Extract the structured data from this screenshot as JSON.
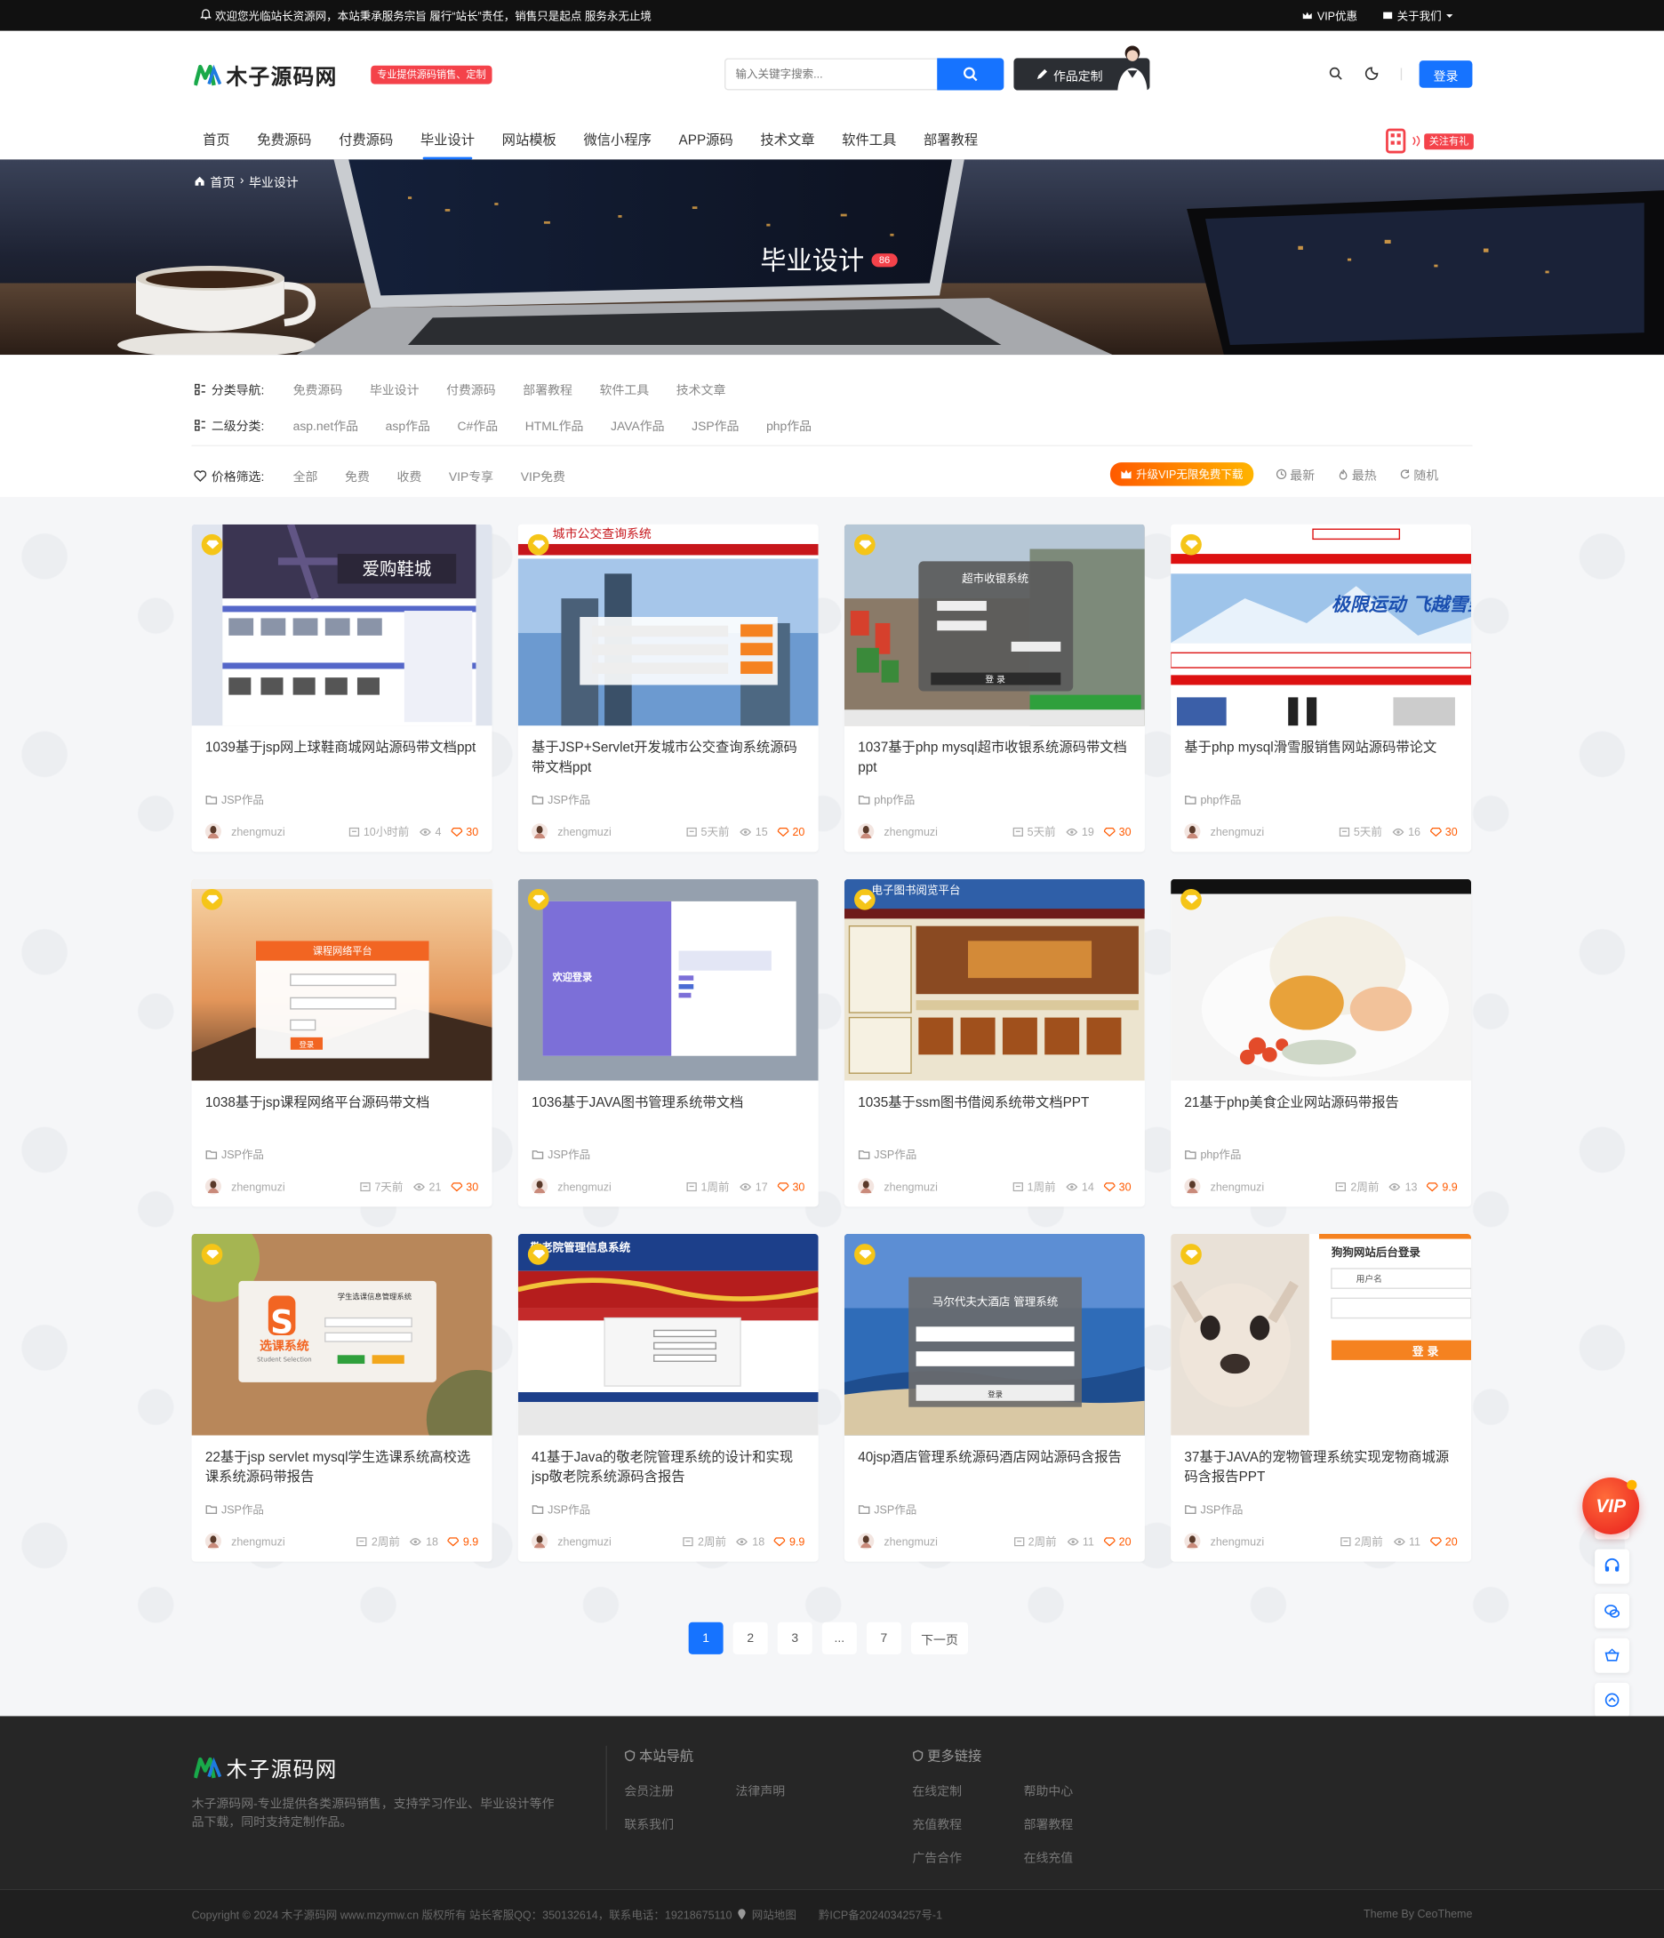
{
  "topbar": {
    "notice": "欢迎您光临站长资源网，本站秉承服务宗旨 履行“站长”责任，销售只是起点 服务永无止境",
    "vip": "VIP优惠",
    "about": "关于我们"
  },
  "header": {
    "logo_text": "木子源码网",
    "slogan": "专业提供源码销售、定制",
    "search_placeholder": "输入关键字搜索...",
    "custom_label": "作品定制",
    "login_label": "登录",
    "follow_label": "关注有礼"
  },
  "nav": [
    "首页",
    "免费源码",
    "付费源码",
    "毕业设计",
    "网站模板",
    "微信小程序",
    "APP源码",
    "技术文章",
    "软件工具",
    "部署教程"
  ],
  "nav_active": "毕业设计",
  "banner": {
    "crumb_home": "首页",
    "crumb_current": "毕业设计",
    "title": "毕业设计",
    "count": "86"
  },
  "filters": {
    "cat_label": "分类导航:",
    "cats": [
      "免费源码",
      "毕业设计",
      "付费源码",
      "部署教程",
      "软件工具",
      "技术文章"
    ],
    "sub_label": "二级分类:",
    "subs": [
      "asp.net作品",
      "asp作品",
      "C#作品",
      "HTML作品",
      "JAVA作品",
      "JSP作品",
      "php作品"
    ],
    "price_label": "价格筛选:",
    "prices": [
      "全部",
      "免费",
      "收费",
      "VIP专享",
      "VIP免费"
    ],
    "vip_button": "升级VIP无限免费下载",
    "sort": [
      "最新",
      "最热",
      "随机"
    ]
  },
  "cards": [
    {
      "title": "1039基于jsp网上球鞋商城网站源码带文档ppt",
      "cat": "JSP作品",
      "author": "zhengmuzi",
      "time": "10小时前",
      "views": "4",
      "price": "30"
    },
    {
      "title": "基于JSP+Servlet开发城市公交查询系统源码带文档ppt",
      "cat": "JSP作品",
      "author": "zhengmuzi",
      "time": "5天前",
      "views": "15",
      "price": "20"
    },
    {
      "title": "1037基于php mysql超市收银系统源码带文档ppt",
      "cat": "php作品",
      "author": "zhengmuzi",
      "time": "5天前",
      "views": "19",
      "price": "30"
    },
    {
      "title": "基于php mysql滑雪服销售网站源码带论文",
      "cat": "php作品",
      "author": "zhengmuzi",
      "time": "5天前",
      "views": "16",
      "price": "30"
    },
    {
      "title": "1038基于jsp课程网络平台源码带文档",
      "cat": "JSP作品",
      "author": "zhengmuzi",
      "time": "7天前",
      "views": "21",
      "price": "30"
    },
    {
      "title": "1036基于JAVA图书管理系统带文档",
      "cat": "JSP作品",
      "author": "zhengmuzi",
      "time": "1周前",
      "views": "17",
      "price": "30"
    },
    {
      "title": "1035基于ssm图书借阅系统带文档PPT",
      "cat": "JSP作品",
      "author": "zhengmuzi",
      "time": "1周前",
      "views": "14",
      "price": "30"
    },
    {
      "title": "21基于php美食企业网站源码带报告",
      "cat": "php作品",
      "author": "zhengmuzi",
      "time": "2周前",
      "views": "13",
      "price": "9.9"
    },
    {
      "title": "22基于jsp servlet mysql学生选课系统高校选课系统源码带报告",
      "cat": "JSP作品",
      "author": "zhengmuzi",
      "time": "2周前",
      "views": "18",
      "price": "9.9"
    },
    {
      "title": "41基于Java的敬老院管理系统的设计和实现jsp敬老院系统源码含报告",
      "cat": "JSP作品",
      "author": "zhengmuzi",
      "time": "2周前",
      "views": "18",
      "price": "9.9"
    },
    {
      "title": "40jsp酒店管理系统源码酒店网站源码含报告",
      "cat": "JSP作品",
      "author": "zhengmuzi",
      "time": "2周前",
      "views": "11",
      "price": "20"
    },
    {
      "title": "37基于JAVA的宠物管理系统实现宠物商城源码含报告PPT",
      "cat": "JSP作品",
      "author": "zhengmuzi",
      "time": "2周前",
      "views": "11",
      "price": "20"
    }
  ],
  "thumbs": {
    "t1_title": "爱购鞋城",
    "t2_title": "城市公交查询系统",
    "t3_title": "超市收银系统",
    "t3_login": "登 录",
    "t4_title": "极限运动 飞越雪野",
    "t5_title": "课程网络平台",
    "t5_btn": "登录",
    "t6_title": "欢迎登录",
    "t7_title": "电子图书阅览平台",
    "t9_title": "选课系统",
    "t9_en": "Student Selection",
    "t9_sys": "学生选课信息管理系统",
    "t10_title": "敬老院管理信息系统",
    "t11_title": "马尔代夫大酒店 管理系统",
    "t11_btn": "登录",
    "t12_title": "狗狗网站后台登录",
    "t12_user": "用户名",
    "t12_btn": "登 录"
  },
  "pager": [
    "1",
    "2",
    "3",
    "...",
    "7",
    "下一页"
  ],
  "footer": {
    "logo_text": "木子源码网",
    "desc": "木子源码网-专业提供各类源码销售，支持学习作业、毕业设计等作品下载，同时支持定制作品。",
    "nav_title": "本站导航",
    "nav_links": [
      "会员注册",
      "法律声明",
      "联系我们"
    ],
    "more_title": "更多链接",
    "more_links": [
      "在线定制",
      "帮助中心",
      "充值教程",
      "部署教程",
      "广告合作",
      "在线充值"
    ],
    "copyright": "Copyright © 2024 木子源码网 www.mzymw.cn 版权所有 站长客服QQ：350132614，联系电话：19218675110",
    "sitemap": "网站地图",
    "icp": "黔ICP备2024034257号-1",
    "theme": "Theme By CeoTheme"
  },
  "vip_float": "VIP",
  "colors": {
    "accent": "#1673ff",
    "red": "#f4424a",
    "orange": "#ff5a00"
  }
}
